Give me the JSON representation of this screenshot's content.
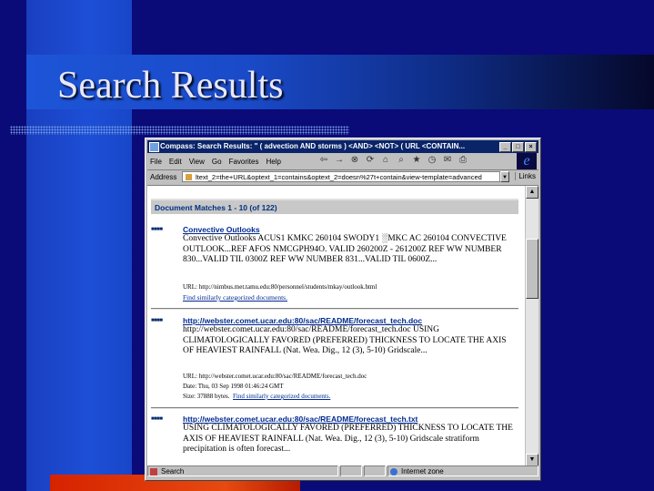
{
  "slide": {
    "title": "Search Results"
  },
  "window": {
    "title": "Compass: Search Results: \" ( advection AND storms ) <AND> <NOT> ( URL <CONTAIN...",
    "buttons": {
      "minimize": "_",
      "maximize": "□",
      "close": "×"
    },
    "menu": [
      "File",
      "Edit",
      "View",
      "Go",
      "Favorites",
      "Help"
    ],
    "address_label": "Address",
    "address_value": "ltext_2=the+URL&optext_1=contains&optext_2=doesn%27t+contain&view-template=advanced",
    "links_label": "Links",
    "ie_logo": "e"
  },
  "content": {
    "matches_header": "Document Matches 1 - 10 (of 122)",
    "bullets": "■ ■ ■ ■",
    "results": [
      {
        "title": "Convective Outlooks",
        "body": "Convective Outlooks ACUS1 KMKC 260104 SWODY1 ░MKC AC 260104 CONVECTIVE OUTLOOK...REF AFOS NMCGPH94O. VALID 260200Z - 261200Z REF WW NUMBER 830...VALID TIL 0300Z REF WW NUMBER 831...VALID TIL 0600Z...",
        "url": "URL: http://nimbus.met.tamu.edu:80/personnel/students/mkay/outlook.html",
        "similar": "Find similarly categorized documents."
      },
      {
        "title": "http://webster.comet.ucar.edu:80/sac/README/forecast_tech.doc",
        "body": "http://webster.comet.ucar.edu:80/sac/README/forecast_tech.doc USING CLIMATOLOGICALLY FAVORED (PREFERRED) THICKNESS TO LOCATE THE AXIS OF HEAVIEST RAINFALL (Nat. Wea. Dig., 12 (3), 5-10) Gridscale...",
        "url": "URL: http://webster.comet.ucar.edu:80/sac/README/forecast_tech.doc",
        "date": "Date: Thu, 03 Sep 1998 01:46:24 GMT",
        "size": "Size: 37888 bytes.",
        "similar": "Find similarly categorized documents."
      },
      {
        "title": "http://webster.comet.ucar.edu:80/sac/README/forecast_tech.txt",
        "body": "USING CLIMATOLOGICALLY FAVORED (PREFERRED) THICKNESS TO LOCATE THE AXIS OF HEAVIEST RAINFALL (Nat. Wea. Dig., 12 (3), 5-10) Gridscale stratiform precipitation is often forecast..."
      }
    ]
  },
  "statusbar": {
    "left": "Search",
    "zone": "Internet zone"
  },
  "colors": {
    "slide_bg": "#0a0a78",
    "accent_red": "#d62200",
    "titlebar": "#0a246a",
    "link": "#002a90"
  }
}
